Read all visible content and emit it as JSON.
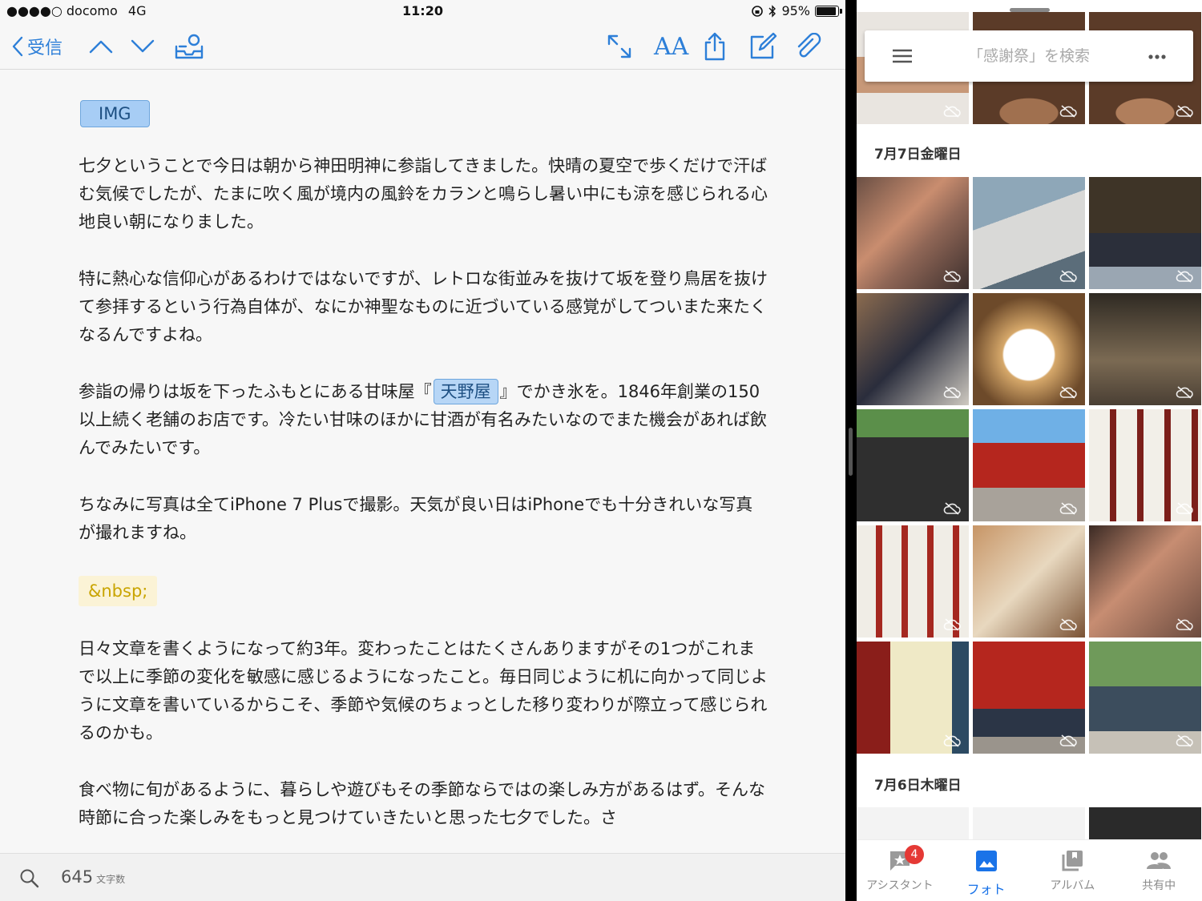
{
  "status_bar": {
    "carrier": "●●●●○ docomo",
    "network": "4G",
    "time": "11:20",
    "battery": "95%",
    "battery_level": 0.95
  },
  "toolbar": {
    "back_label": "受信",
    "icons": [
      "chevron-left-icon",
      "chevron-up-icon",
      "chevron-down-icon",
      "inbox-archive-icon",
      "expand-icon",
      "font-size-icon",
      "share-icon",
      "compose-icon",
      "attach-icon"
    ],
    "font_size_label": "AA"
  },
  "content": {
    "img_tag": "IMG",
    "p1": "七夕ということで今日は朝から神田明神に参詣してきました。快晴の夏空で歩くだけで汗ばむ気候でしたが、たまに吹く風が境内の風鈴をカランと鳴らし暑い中にも涼を感じられる心地良い朝になりました。",
    "p2": "特に熱心な信仰心があるわけではないですが、レトロな街並みを抜けて坂を登り鳥居を抜けて参拝するという行為自体が、なにか神聖なものに近づいている感覚がしてついまた来たくなるんですよね。",
    "p3_before": "参詣の帰りは坂を下ったふもとにある甘味屋『",
    "p3_tag": "天野屋",
    "p3_after": "』でかき氷を。1846年創業の150以上続く老舗のお店です。冷たい甘味のほかに甘酒が有名みたいなのでまた機会があれば飲んでみたいです。",
    "p4": "ちなみに写真は全てiPhone 7 Plusで撮影。天気が良い日はiPhoneでも十分きれいな写真が撮れますね。",
    "nbsp": "&nbsp;",
    "p5": "日々文章を書くようになって約3年。変わったことはたくさんありますがその1つがこれまで以上に季節の変化を敏感に感じるようになったこと。毎日同じように机に向かって同じように文章を書いているからこそ、季節や気候のちょっとした移り変わりが際立って感じられるのかも。",
    "p6": "食べ物に旬があるように、暮らしや遊びもその季節ならではの楽しみ方があるはず。そんな時節に合った楽しみをもっと見つけていきたいと思った七夕でした。さ"
  },
  "bottom_bar": {
    "word_count": "645",
    "word_count_unit": "文字数"
  },
  "photos": {
    "search_placeholder": "「感謝祭」を検索",
    "date_1": "7月7日金曜日",
    "date_2": "7月6日木曜日",
    "nav": [
      {
        "label": "アシスタント",
        "badge": "4"
      },
      {
        "label": "フォト"
      },
      {
        "label": "アルバム"
      },
      {
        "label": "共有中"
      }
    ],
    "colors": {
      "accent": "#1a73e8",
      "badge": "#e53935",
      "editor_link": "#2d7fd8"
    }
  }
}
